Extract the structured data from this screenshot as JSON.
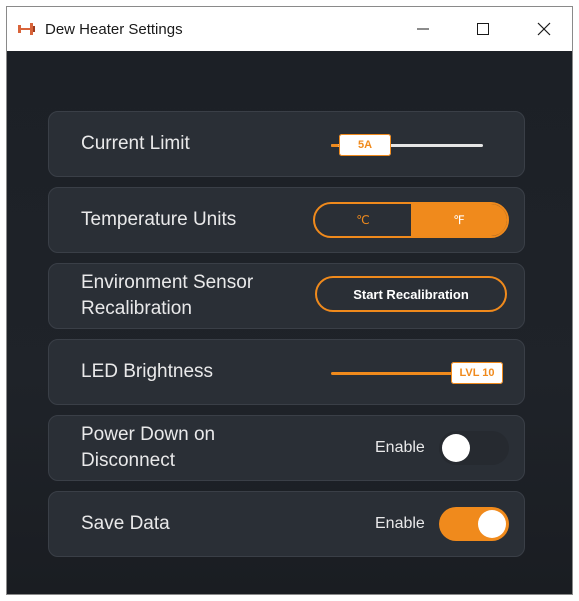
{
  "window": {
    "title": "Dew Heater Settings",
    "icon": "dew-heater-app-icon",
    "controls": [
      "minimize-icon",
      "maximize-icon",
      "close-icon"
    ]
  },
  "settings": {
    "current_limit": {
      "label": "Current Limit",
      "value_label": "5A",
      "value": 0.05
    },
    "temperature_units": {
      "label": "Temperature Units",
      "options": [
        "℃",
        "℉"
      ],
      "selected": "℉"
    },
    "recalibration": {
      "label_line1": "Environment Sensor",
      "label_line2": "Recalibration",
      "button_label": "Start Recalibration"
    },
    "led_brightness": {
      "label": "LED Brightness",
      "value_label": "LVL 10",
      "value": 1.0
    },
    "power_down": {
      "label_line1": "Power Down on",
      "label_line2": "Disconnect",
      "toggle_label": "Enable",
      "enabled": false
    },
    "save_data": {
      "label": "Save Data",
      "toggle_label": "Enable",
      "enabled": true
    }
  },
  "colors": {
    "accent": "#f08a1c",
    "panel": "#2a2f36",
    "background": "#1c2026",
    "text": "#e9e9ea"
  }
}
